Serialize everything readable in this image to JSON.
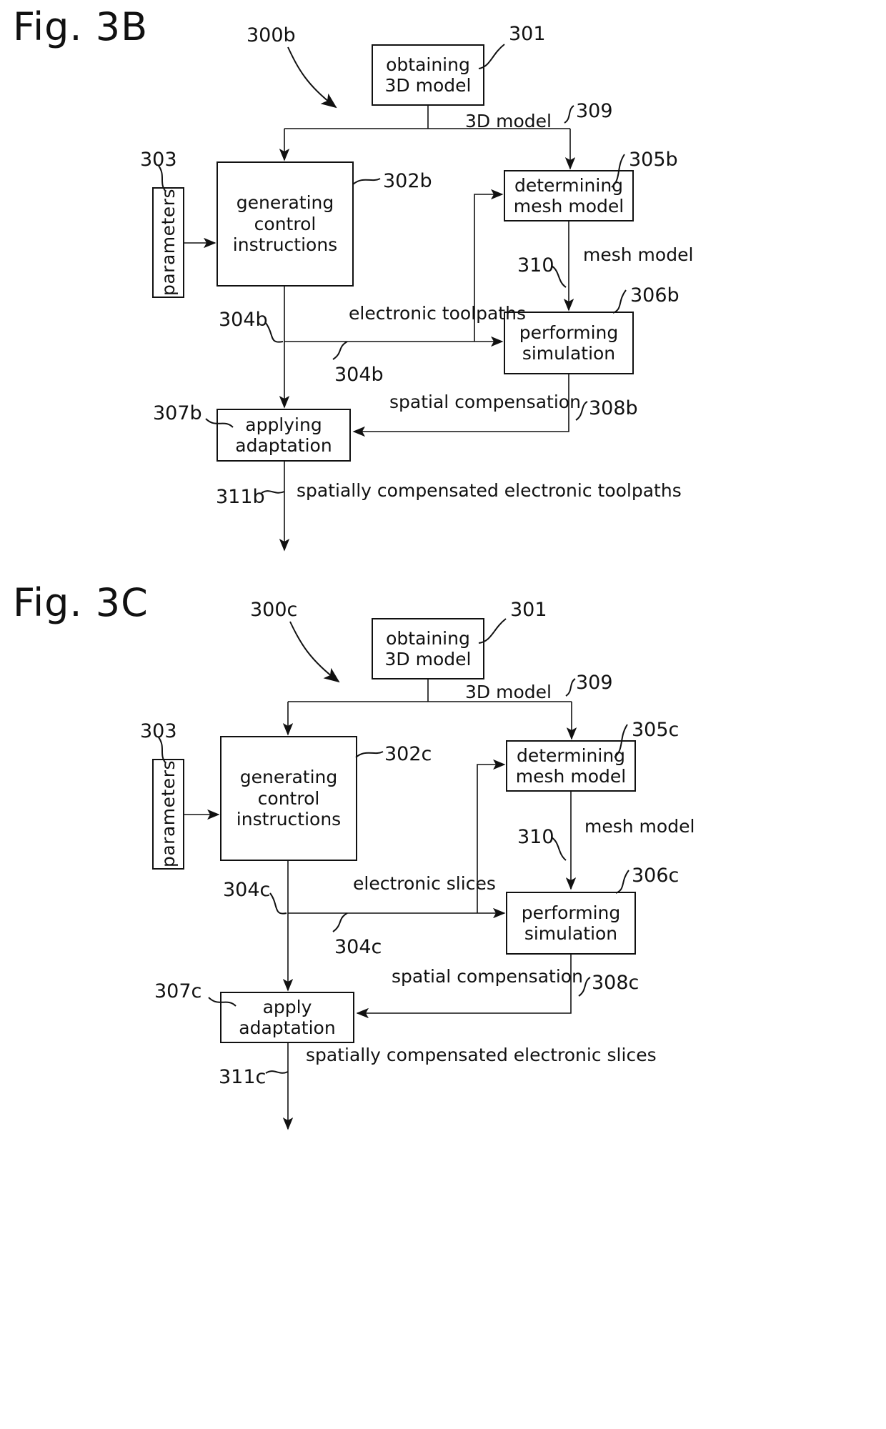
{
  "figures": [
    {
      "label": "Fig. 3B",
      "flow_ref": "300b",
      "boxes": {
        "obtaining": {
          "line1": "obtaining",
          "line2": "3D model",
          "ref": "301"
        },
        "generating": {
          "line1": "generating",
          "line2": "control",
          "line3": "instructions",
          "ref": "302b"
        },
        "parameters": {
          "text": "parameters",
          "ref": "303"
        },
        "determining": {
          "line1": "determining",
          "line2": "mesh model",
          "ref": "305b"
        },
        "performing": {
          "line1": "performing",
          "line2": "simulation",
          "ref": "306b"
        },
        "applying": {
          "line1": "applying",
          "line2": "adaptation",
          "ref": "307b"
        }
      },
      "edges": {
        "model_3d": {
          "label": "3D model",
          "ref": "309"
        },
        "mesh_model": {
          "label": "mesh model",
          "ref": "310"
        },
        "control_out": {
          "line1": "electronic",
          "line2": "toolpaths",
          "ref_left": "304b",
          "ref_mid": "304b"
        },
        "compensation": {
          "line1": "spatial",
          "line2": "compensation",
          "ref": "308b"
        },
        "output": {
          "line1": "spatially",
          "line2": "compensated",
          "line3": "electronic toolpaths",
          "ref": "311b"
        }
      }
    },
    {
      "label": "Fig. 3C",
      "flow_ref": "300c",
      "boxes": {
        "obtaining": {
          "line1": "obtaining",
          "line2": "3D model",
          "ref": "301"
        },
        "generating": {
          "line1": "generating",
          "line2": "control",
          "line3": "instructions",
          "ref": "302c"
        },
        "parameters": {
          "text": "parameters",
          "ref": "303"
        },
        "determining": {
          "line1": "determining",
          "line2": "mesh model",
          "ref": "305c"
        },
        "performing": {
          "line1": "performing",
          "line2": "simulation",
          "ref": "306c"
        },
        "applying": {
          "line1": "apply",
          "line2": "adaptation",
          "ref": "307c"
        }
      },
      "edges": {
        "model_3d": {
          "label": "3D model",
          "ref": "309"
        },
        "mesh_model": {
          "label": "mesh model",
          "ref": "310"
        },
        "control_out": {
          "line1": "electronic",
          "line2": "slices",
          "ref_left": "304c",
          "ref_mid": "304c"
        },
        "compensation": {
          "line1": "spatial",
          "line2": "compensation",
          "ref": "308c"
        },
        "output": {
          "line1": "spatially",
          "line2": "compensated",
          "line3": "electronic slices",
          "ref": "311c"
        }
      }
    }
  ]
}
